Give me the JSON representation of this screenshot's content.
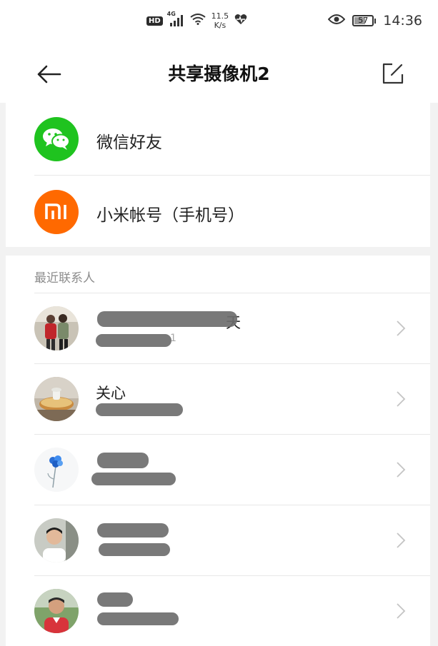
{
  "status_bar": {
    "hd": "HD",
    "net": "4G",
    "speed_value": "11.5",
    "speed_unit": "K/s",
    "battery": "57",
    "time": "14:36",
    "icons": [
      "signal-icon",
      "wifi-icon",
      "health-icon",
      "eye-icon",
      "battery-icon"
    ]
  },
  "nav": {
    "title": "共享摄像机2",
    "back_icon": "back-arrow-icon",
    "edit_icon": "edit-icon"
  },
  "share_options": [
    {
      "label": "微信好友",
      "icon": "wechat-icon",
      "color": "#1fc31f"
    },
    {
      "label": "小米帐号（手机号）",
      "icon": "mi-logo-icon",
      "color": "#ff6900"
    }
  ],
  "recent": {
    "header": "最近联系人",
    "contacts": [
      {
        "name": "天",
        "sub": "1"
      },
      {
        "name": "关心",
        "sub": ""
      },
      {
        "name": "",
        "sub": ""
      },
      {
        "name": "",
        "sub": ""
      },
      {
        "name": "",
        "sub": ""
      }
    ]
  }
}
